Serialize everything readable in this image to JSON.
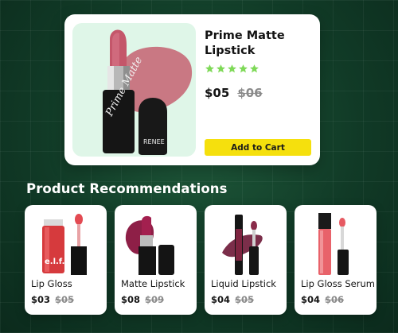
{
  "featured": {
    "title": "Prime Matte Lipstick",
    "rating_stars": 5,
    "price_current": "$05",
    "price_original": "$06",
    "add_to_cart_label": "Add to Cart",
    "tube_text": "Prime Matte",
    "cap_text": "RENEE"
  },
  "recommendations": {
    "title": "Product Recommendations",
    "items": [
      {
        "name": "Lip Gloss",
        "price_current": "$03",
        "price_original": "$05",
        "brand_text": "e.l.f."
      },
      {
        "name": "Matte Lipstick",
        "price_current": "$08",
        "price_original": "$09"
      },
      {
        "name": "Liquid Lipstick",
        "price_current": "$04",
        "price_original": "$05"
      },
      {
        "name": "Lip Gloss Serum",
        "price_current": "$04",
        "price_original": "$06"
      }
    ]
  },
  "colors": {
    "background": "#113b27",
    "button": "#f5e00d",
    "star": "#7ed957"
  }
}
